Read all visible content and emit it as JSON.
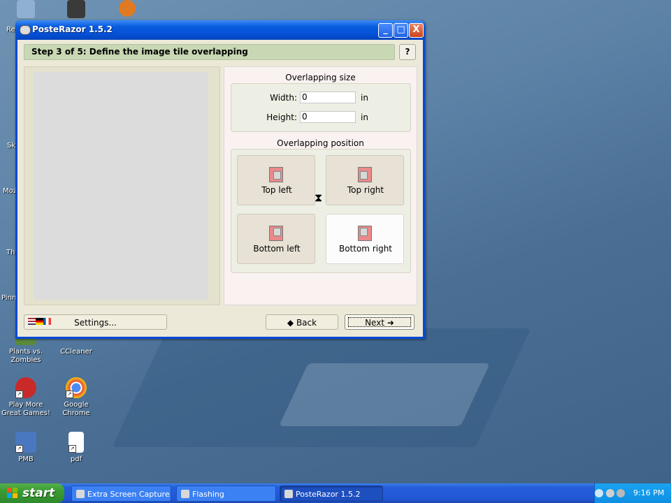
{
  "desktop": {
    "edge_labels": [
      "Re",
      "Sk",
      "Moz",
      "Th",
      "Pinn"
    ],
    "icons": [
      {
        "label": "Plants vs. Zombies",
        "color": "#5a8a3a"
      },
      {
        "label": "CCleaner",
        "color": "#c04040"
      },
      {
        "label": "Play More Great Games!",
        "color": "#c82a2a"
      },
      {
        "label": "Google Chrome",
        "color": "#3a9a3a"
      },
      {
        "label": "PMB",
        "color": "#4a78c0"
      },
      {
        "label": "pdf",
        "color": "#ffffff"
      }
    ]
  },
  "window": {
    "title": "PosteRazor 1.5.2",
    "buttons": {
      "minimize": "_",
      "maximize": "□",
      "close": "X"
    },
    "step_title": "Step 3 of 5: Define the image tile overlapping",
    "help_label": "?",
    "overlap_size": {
      "title": "Overlapping size",
      "width_label": "Width:",
      "width_value": "0",
      "height_label": "Height:",
      "height_value": "0",
      "unit": "in"
    },
    "overlap_position": {
      "title": "Overlapping position",
      "options": [
        "Top left",
        "Top right",
        "Bottom left",
        "Bottom right"
      ],
      "selected": "Bottom right"
    },
    "settings_label": "Settings...",
    "back_label": "◆ Back",
    "next_label": "Next ➜"
  },
  "taskbar": {
    "start_label": "start",
    "items": [
      {
        "label": "Extra Screen Capture..."
      },
      {
        "label": "Flashing"
      },
      {
        "label": "PosteRazor 1.5.2"
      }
    ],
    "clock": "9:16 PM"
  }
}
